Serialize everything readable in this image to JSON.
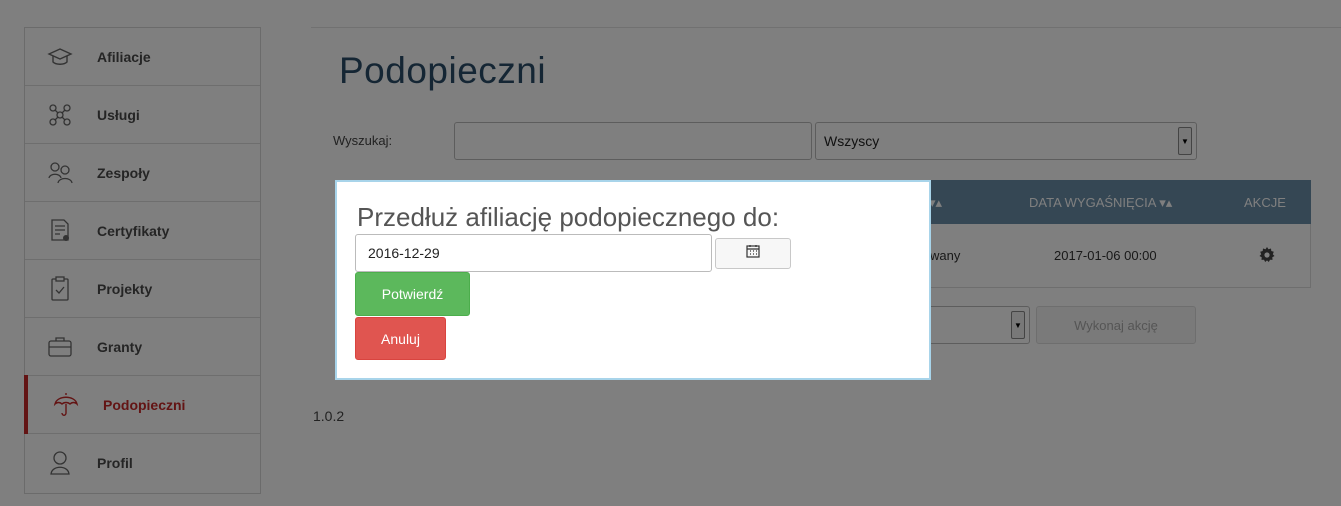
{
  "sidebar": {
    "items": [
      {
        "label": "Afiliacje",
        "icon": "graduation-cap-icon"
      },
      {
        "label": "Usługi",
        "icon": "network-icon"
      },
      {
        "label": "Zespoły",
        "icon": "users-group-icon"
      },
      {
        "label": "Certyfikaty",
        "icon": "certificate-icon"
      },
      {
        "label": "Projekty",
        "icon": "clipboard-icon"
      },
      {
        "label": "Granty",
        "icon": "briefcase-icon"
      },
      {
        "label": "Podopieczni",
        "icon": "umbrella-icon",
        "active": true
      },
      {
        "label": "Profil",
        "icon": "user-icon"
      }
    ],
    "active_color": "#c62828"
  },
  "main": {
    "title": "Podopieczni",
    "search_label": "Wyszukaj:",
    "search_value": "",
    "filter_value": "Wszyscy",
    "table": {
      "columns": [
        "DATA WYGAŚNIĘCIA",
        "AKCJE"
      ],
      "sort_glyph": "▾▴",
      "rows": [
        {
          "status_fragment": "wany",
          "expiry": "2017-01-06 00:00",
          "action_icon": "gear-icon"
        }
      ]
    },
    "bulk_action_button": "Wykonaj akcję",
    "header_color": "#6a8ea8"
  },
  "footer": {
    "version": "1.0.2"
  },
  "modal": {
    "title": "Przedłuż afiliację podopiecznego do:",
    "date_value": "2016-12-29",
    "calendar_icon": "calendar-icon",
    "confirm_label": "Potwierdź",
    "cancel_label": "Anuluj",
    "confirm_color": "#5cb85c",
    "cancel_color": "#e05550"
  }
}
